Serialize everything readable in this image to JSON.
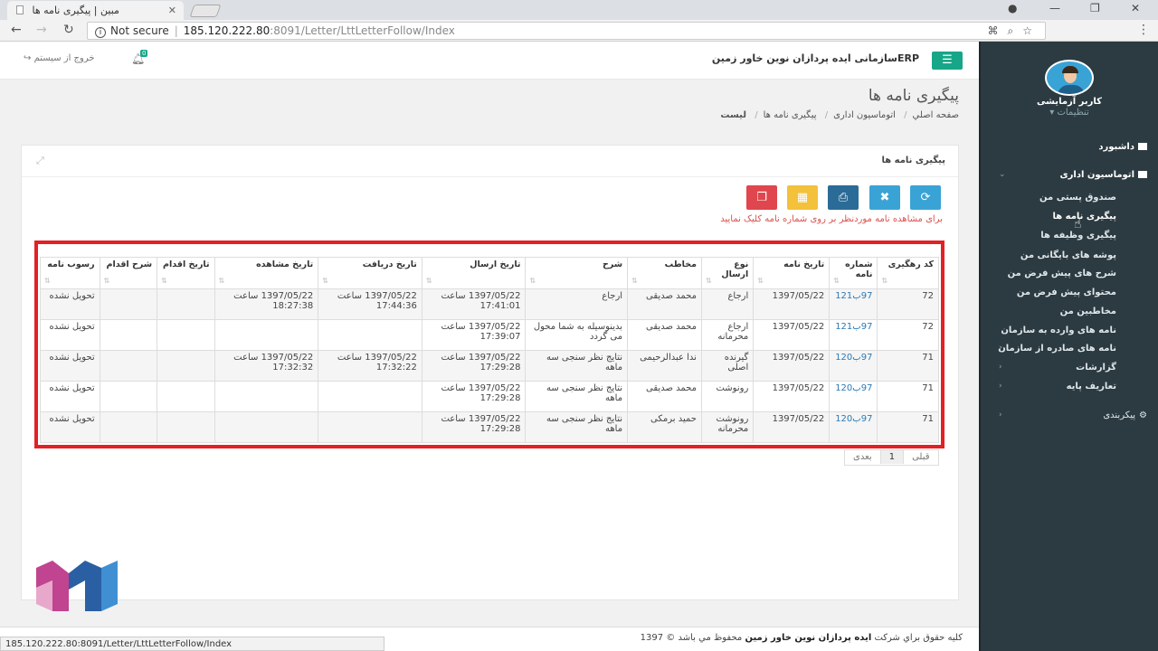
{
  "browser": {
    "tab_title": "مبین | پیگیری نامه ها",
    "security_label": "Not secure",
    "url_host": "185.120.222.80",
    "url_path": ":8091/Letter/LttLetterFollow/Index",
    "status_url": "185.120.222.80:8091/Letter/LttLetterFollow/Index"
  },
  "header": {
    "app_title": "ERPسازمانی ایده پردازان نوین خاور زمین",
    "notification_count": "0",
    "logout_label": "خروج از سیستم"
  },
  "user": {
    "name": "کاربر آزمایشی",
    "settings_label": "تنظیمات"
  },
  "sidebar": {
    "dashboard": "داشبورد",
    "office_automation": "اتوماسیون اداری",
    "items": [
      "صندوق پستی من",
      "پیگیری نامه ها",
      "پیگیری وظیفه ها",
      "پوشه های بایگانی من",
      "شرح های پیش فرض من",
      "محتوای پیش فرض من",
      "مخاطبین من",
      "نامه های وارده به سازمان",
      "نامه های صادره از سازمان",
      "گزارشات",
      "تعاریف پایه"
    ],
    "configuration": "پیکربندی"
  },
  "page": {
    "title": "پیگیری نامه ها",
    "breadcrumb": [
      "صفحه اصلي",
      "اتوماسیون اداری",
      "پیگیری نامه ها",
      "لیست"
    ]
  },
  "panel": {
    "title": "پیگیری نامه ها",
    "hint": "برای مشاهده نامه موردنظر بر روی شماره نامه کلیک نمایید"
  },
  "colors": {
    "accent": "#18a689",
    "highlight_frame": "#e22026",
    "sidebar_bg": "#2c3b41"
  },
  "table": {
    "headers": [
      "کد رهگیری",
      "شماره نامه",
      "تاریخ نامه",
      "نوع ارسال",
      "مخاطب",
      "شرح",
      "تاریخ ارسال",
      "تاریخ دریافت",
      "تاریخ مشاهده",
      "تاریخ اقدام",
      "شرح اقدام",
      "رسوب نامه"
    ],
    "rows": [
      [
        "72",
        "97ب121",
        "1397/05/22",
        "ارجاع",
        "محمد صدیقی",
        "ارجاع",
        "1397/05/22 ساعت 17:41:01",
        "1397/05/22 ساعت 17:44:36",
        "1397/05/22 ساعت 18:27:38",
        "",
        "",
        "تحویل نشده"
      ],
      [
        "72",
        "97ب121",
        "1397/05/22",
        "ارجاع محرمانه",
        "محمد صدیقی",
        "بدینوسیله به شما محول می گردد",
        "1397/05/22 ساعت 17:39:07",
        "",
        "",
        "",
        "",
        "تحویل نشده"
      ],
      [
        "71",
        "97ب120",
        "1397/05/22",
        "گیرنده اصلی",
        "ندا عبدالرحیمی",
        "نتایج نظر سنجی سه ماهه",
        "1397/05/22 ساعت 17:29:28",
        "1397/05/22 ساعت 17:32:22",
        "1397/05/22 ساعت 17:32:32",
        "",
        "",
        "تحویل نشده"
      ],
      [
        "71",
        "97ب120",
        "1397/05/22",
        "رونوشت",
        "محمد صدیقی",
        "نتایج نظر سنجی سه ماهه",
        "1397/05/22 ساعت 17:29:28",
        "",
        "",
        "",
        "",
        "تحویل نشده"
      ],
      [
        "71",
        "97ب120",
        "1397/05/22",
        "رونوشت محرمانه",
        "حمید برمکی",
        "نتایج نظر سنجی سه ماهه",
        "1397/05/22 ساعت 17:29:28",
        "",
        "",
        "",
        "",
        "تحویل نشده"
      ]
    ]
  },
  "pager": {
    "prev": "قبلی",
    "current": "1",
    "next": "بعدی"
  },
  "footer": {
    "prefix": "کلیه حقوق براي شرکت",
    "company": "ایده پردازان نوین خاور زمین",
    "suffix": "محفوظ مي باشد © 1397"
  }
}
